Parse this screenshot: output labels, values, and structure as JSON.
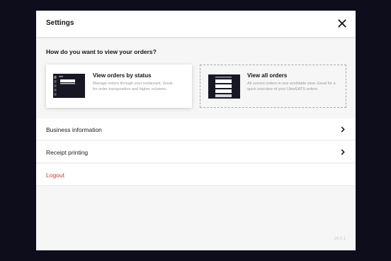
{
  "modal": {
    "title": "Settings",
    "close_icon": "close-icon"
  },
  "view_selection": {
    "question": "How do you want to view your orders?",
    "options": [
      {
        "title": "View orders by status",
        "description": "Manage orders through your restaurant. Great for order transposition and higher volumes.",
        "selected": true,
        "icon": "status-layout-thumbnail"
      },
      {
        "title": "View all orders",
        "description": "All current orders in one scrollable view. Great for a quick overview of your UberEATS orders.",
        "selected": false,
        "icon": "list-layout-thumbnail"
      }
    ]
  },
  "menu": {
    "items": [
      {
        "label": "Business information",
        "icon": "chevron-right-icon"
      },
      {
        "label": "Receipt printing",
        "icon": "chevron-right-icon"
      },
      {
        "label": "Logout"
      }
    ]
  },
  "version": "18.0.1",
  "colors": {
    "background": "#0e0d1c",
    "logout": "#d3352b",
    "thumbnail": "#171823"
  }
}
